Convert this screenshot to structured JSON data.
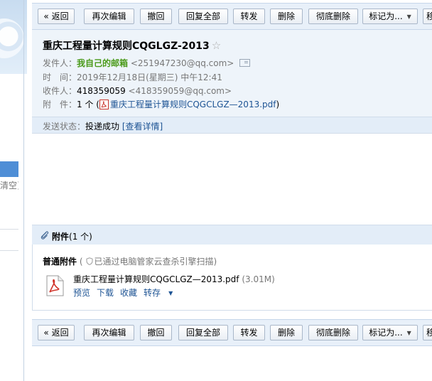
{
  "toolbar": {
    "back": "« 返回",
    "reedit": "再次编辑",
    "recall": "撤回",
    "reply_all": "回复全部",
    "forward": "转发",
    "delete": "删除",
    "delete_permanently": "彻底删除",
    "mark_as": "标记为...",
    "cut_off_next": "移"
  },
  "sidebar": {
    "clear_link": "清空]"
  },
  "email": {
    "subject": "重庆工程量计算规则CQGLGZ-2013",
    "star": "☆",
    "sender_label": "发件人：",
    "sender_name": "我自己的邮箱",
    "sender_addr": " <251947230@qq.com>",
    "time_label": "时　间：",
    "time_value": "2019年12月18日(星期三) 中午12:41",
    "recipient_label": "收件人：",
    "recipient_name": "418359059",
    "recipient_addr": " <418359059@qq.com>",
    "attachment_label": "附　件：",
    "attachment_count": "1 个 (",
    "attachment_link": "重庆工程量计算规则CQGCLGZ—2013.pdf",
    "attachment_close": ")",
    "send_status_label": "发送状态：",
    "send_status_value": "投递成功",
    "send_status_detail": "[查看详情]"
  },
  "attachments": {
    "title": "附件",
    "count": "(1 个)",
    "normal_label": "普通附件",
    "scan_open": "(",
    "scan_note": "已通过电脑管家云查杀引擎扫描)",
    "file_name": "重庆工程量计算规则CQGCLGZ—2013.pdf",
    "file_size": " (3.01M)",
    "preview": "预览",
    "download": "下载",
    "collect": "收藏",
    "save_to": "转存"
  },
  "colors": {
    "toolbar_bg": "#e8f0f9",
    "header_bg": "#eef4fa",
    "link": "#1e5494",
    "sender_green": "#4a9a1a"
  }
}
